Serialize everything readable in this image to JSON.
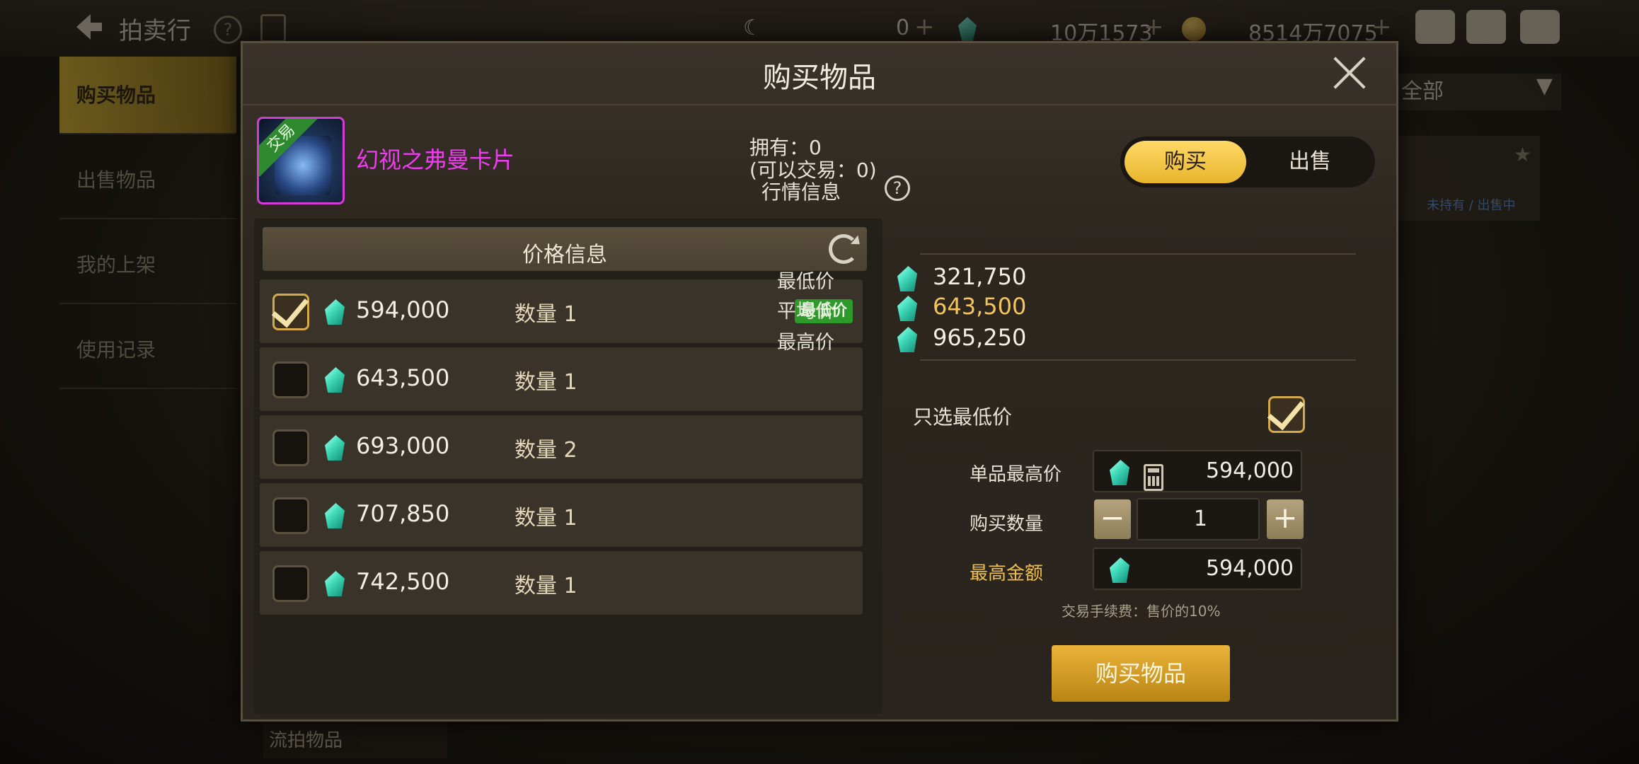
{
  "background": {
    "title": "拍卖行",
    "resources": [
      {
        "value": "0",
        "icon": "moon-currency-icon"
      },
      {
        "value": "10万1573",
        "icon": "gem-icon"
      },
      {
        "value": "8514万7075",
        "icon": "gold-coin-icon"
      }
    ],
    "menu": [
      "购买物品",
      "出售物品",
      "我的上架",
      "使用记录"
    ],
    "filter_text": "全部",
    "status_text": "未持有 / 出售中",
    "bottom_text": "流拍物品"
  },
  "modal": {
    "title": "购买物品",
    "item": {
      "name": "幻视之弗曼卡片",
      "trade_tag": "交易",
      "name_color": "#f03cf0"
    },
    "owned_line1": "拥有：0",
    "owned_line2": "(可以交易：0)",
    "tabs": {
      "buy": "购买",
      "sell": "出售",
      "active": "buy"
    },
    "price_list": {
      "header": "价格信息",
      "qty_prefix": "数量",
      "rows": [
        {
          "price": "594,000",
          "qty": "数量 1",
          "checked": true,
          "badge": "最低价"
        },
        {
          "price": "643,500",
          "qty": "数量 1",
          "checked": false
        },
        {
          "price": "693,000",
          "qty": "数量 2",
          "checked": false
        },
        {
          "price": "707,850",
          "qty": "数量 1",
          "checked": false
        },
        {
          "price": "742,500",
          "qty": "数量 1",
          "checked": false
        }
      ]
    },
    "market": {
      "title": "行情信息",
      "lowest_label": "最低价",
      "lowest_value": "321,750",
      "avg_label": "平均价",
      "avg_value": "643,500",
      "highest_label": "最高价",
      "highest_value": "965,250"
    },
    "only_lowest_label": "只选最低价",
    "only_lowest_checked": true,
    "form": {
      "unit_max_label": "单品最高价",
      "unit_max_value": "594,000",
      "qty_label": "购买数量",
      "qty_value": "1",
      "total_label": "最高金额",
      "total_value": "594,000"
    },
    "fee_note": "交易手续费：售价的10%",
    "buy_button": "购买物品"
  },
  "colors": {
    "accent_gold": "#f2c04a",
    "gem": "#45e0bf",
    "badge_green": "#2e9a2a"
  }
}
